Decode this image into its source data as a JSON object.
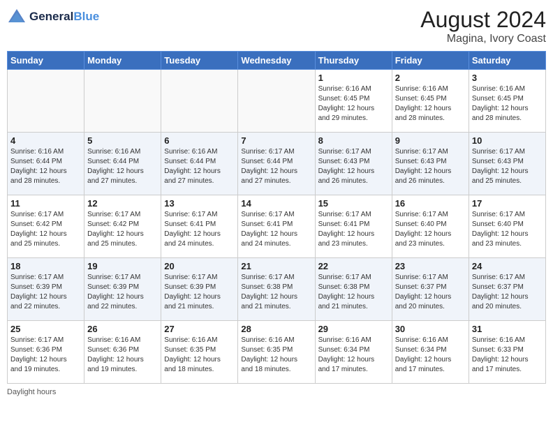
{
  "header": {
    "logo_line1": "General",
    "logo_line2": "Blue",
    "month_year": "August 2024",
    "location": "Magina, Ivory Coast"
  },
  "days_of_week": [
    "Sunday",
    "Monday",
    "Tuesday",
    "Wednesday",
    "Thursday",
    "Friday",
    "Saturday"
  ],
  "weeks": [
    [
      {
        "day": "",
        "info": ""
      },
      {
        "day": "",
        "info": ""
      },
      {
        "day": "",
        "info": ""
      },
      {
        "day": "",
        "info": ""
      },
      {
        "day": "1",
        "info": "Sunrise: 6:16 AM\nSunset: 6:45 PM\nDaylight: 12 hours\nand 29 minutes."
      },
      {
        "day": "2",
        "info": "Sunrise: 6:16 AM\nSunset: 6:45 PM\nDaylight: 12 hours\nand 28 minutes."
      },
      {
        "day": "3",
        "info": "Sunrise: 6:16 AM\nSunset: 6:45 PM\nDaylight: 12 hours\nand 28 minutes."
      }
    ],
    [
      {
        "day": "4",
        "info": "Sunrise: 6:16 AM\nSunset: 6:44 PM\nDaylight: 12 hours\nand 28 minutes."
      },
      {
        "day": "5",
        "info": "Sunrise: 6:16 AM\nSunset: 6:44 PM\nDaylight: 12 hours\nand 27 minutes."
      },
      {
        "day": "6",
        "info": "Sunrise: 6:16 AM\nSunset: 6:44 PM\nDaylight: 12 hours\nand 27 minutes."
      },
      {
        "day": "7",
        "info": "Sunrise: 6:17 AM\nSunset: 6:44 PM\nDaylight: 12 hours\nand 27 minutes."
      },
      {
        "day": "8",
        "info": "Sunrise: 6:17 AM\nSunset: 6:43 PM\nDaylight: 12 hours\nand 26 minutes."
      },
      {
        "day": "9",
        "info": "Sunrise: 6:17 AM\nSunset: 6:43 PM\nDaylight: 12 hours\nand 26 minutes."
      },
      {
        "day": "10",
        "info": "Sunrise: 6:17 AM\nSunset: 6:43 PM\nDaylight: 12 hours\nand 25 minutes."
      }
    ],
    [
      {
        "day": "11",
        "info": "Sunrise: 6:17 AM\nSunset: 6:42 PM\nDaylight: 12 hours\nand 25 minutes."
      },
      {
        "day": "12",
        "info": "Sunrise: 6:17 AM\nSunset: 6:42 PM\nDaylight: 12 hours\nand 25 minutes."
      },
      {
        "day": "13",
        "info": "Sunrise: 6:17 AM\nSunset: 6:41 PM\nDaylight: 12 hours\nand 24 minutes."
      },
      {
        "day": "14",
        "info": "Sunrise: 6:17 AM\nSunset: 6:41 PM\nDaylight: 12 hours\nand 24 minutes."
      },
      {
        "day": "15",
        "info": "Sunrise: 6:17 AM\nSunset: 6:41 PM\nDaylight: 12 hours\nand 23 minutes."
      },
      {
        "day": "16",
        "info": "Sunrise: 6:17 AM\nSunset: 6:40 PM\nDaylight: 12 hours\nand 23 minutes."
      },
      {
        "day": "17",
        "info": "Sunrise: 6:17 AM\nSunset: 6:40 PM\nDaylight: 12 hours\nand 23 minutes."
      }
    ],
    [
      {
        "day": "18",
        "info": "Sunrise: 6:17 AM\nSunset: 6:39 PM\nDaylight: 12 hours\nand 22 minutes."
      },
      {
        "day": "19",
        "info": "Sunrise: 6:17 AM\nSunset: 6:39 PM\nDaylight: 12 hours\nand 22 minutes."
      },
      {
        "day": "20",
        "info": "Sunrise: 6:17 AM\nSunset: 6:39 PM\nDaylight: 12 hours\nand 21 minutes."
      },
      {
        "day": "21",
        "info": "Sunrise: 6:17 AM\nSunset: 6:38 PM\nDaylight: 12 hours\nand 21 minutes."
      },
      {
        "day": "22",
        "info": "Sunrise: 6:17 AM\nSunset: 6:38 PM\nDaylight: 12 hours\nand 21 minutes."
      },
      {
        "day": "23",
        "info": "Sunrise: 6:17 AM\nSunset: 6:37 PM\nDaylight: 12 hours\nand 20 minutes."
      },
      {
        "day": "24",
        "info": "Sunrise: 6:17 AM\nSunset: 6:37 PM\nDaylight: 12 hours\nand 20 minutes."
      }
    ],
    [
      {
        "day": "25",
        "info": "Sunrise: 6:17 AM\nSunset: 6:36 PM\nDaylight: 12 hours\nand 19 minutes."
      },
      {
        "day": "26",
        "info": "Sunrise: 6:16 AM\nSunset: 6:36 PM\nDaylight: 12 hours\nand 19 minutes."
      },
      {
        "day": "27",
        "info": "Sunrise: 6:16 AM\nSunset: 6:35 PM\nDaylight: 12 hours\nand 18 minutes."
      },
      {
        "day": "28",
        "info": "Sunrise: 6:16 AM\nSunset: 6:35 PM\nDaylight: 12 hours\nand 18 minutes."
      },
      {
        "day": "29",
        "info": "Sunrise: 6:16 AM\nSunset: 6:34 PM\nDaylight: 12 hours\nand 17 minutes."
      },
      {
        "day": "30",
        "info": "Sunrise: 6:16 AM\nSunset: 6:34 PM\nDaylight: 12 hours\nand 17 minutes."
      },
      {
        "day": "31",
        "info": "Sunrise: 6:16 AM\nSunset: 6:33 PM\nDaylight: 12 hours\nand 17 minutes."
      }
    ]
  ],
  "footer": {
    "note": "Daylight hours"
  },
  "alt_rows": [
    1,
    3
  ]
}
